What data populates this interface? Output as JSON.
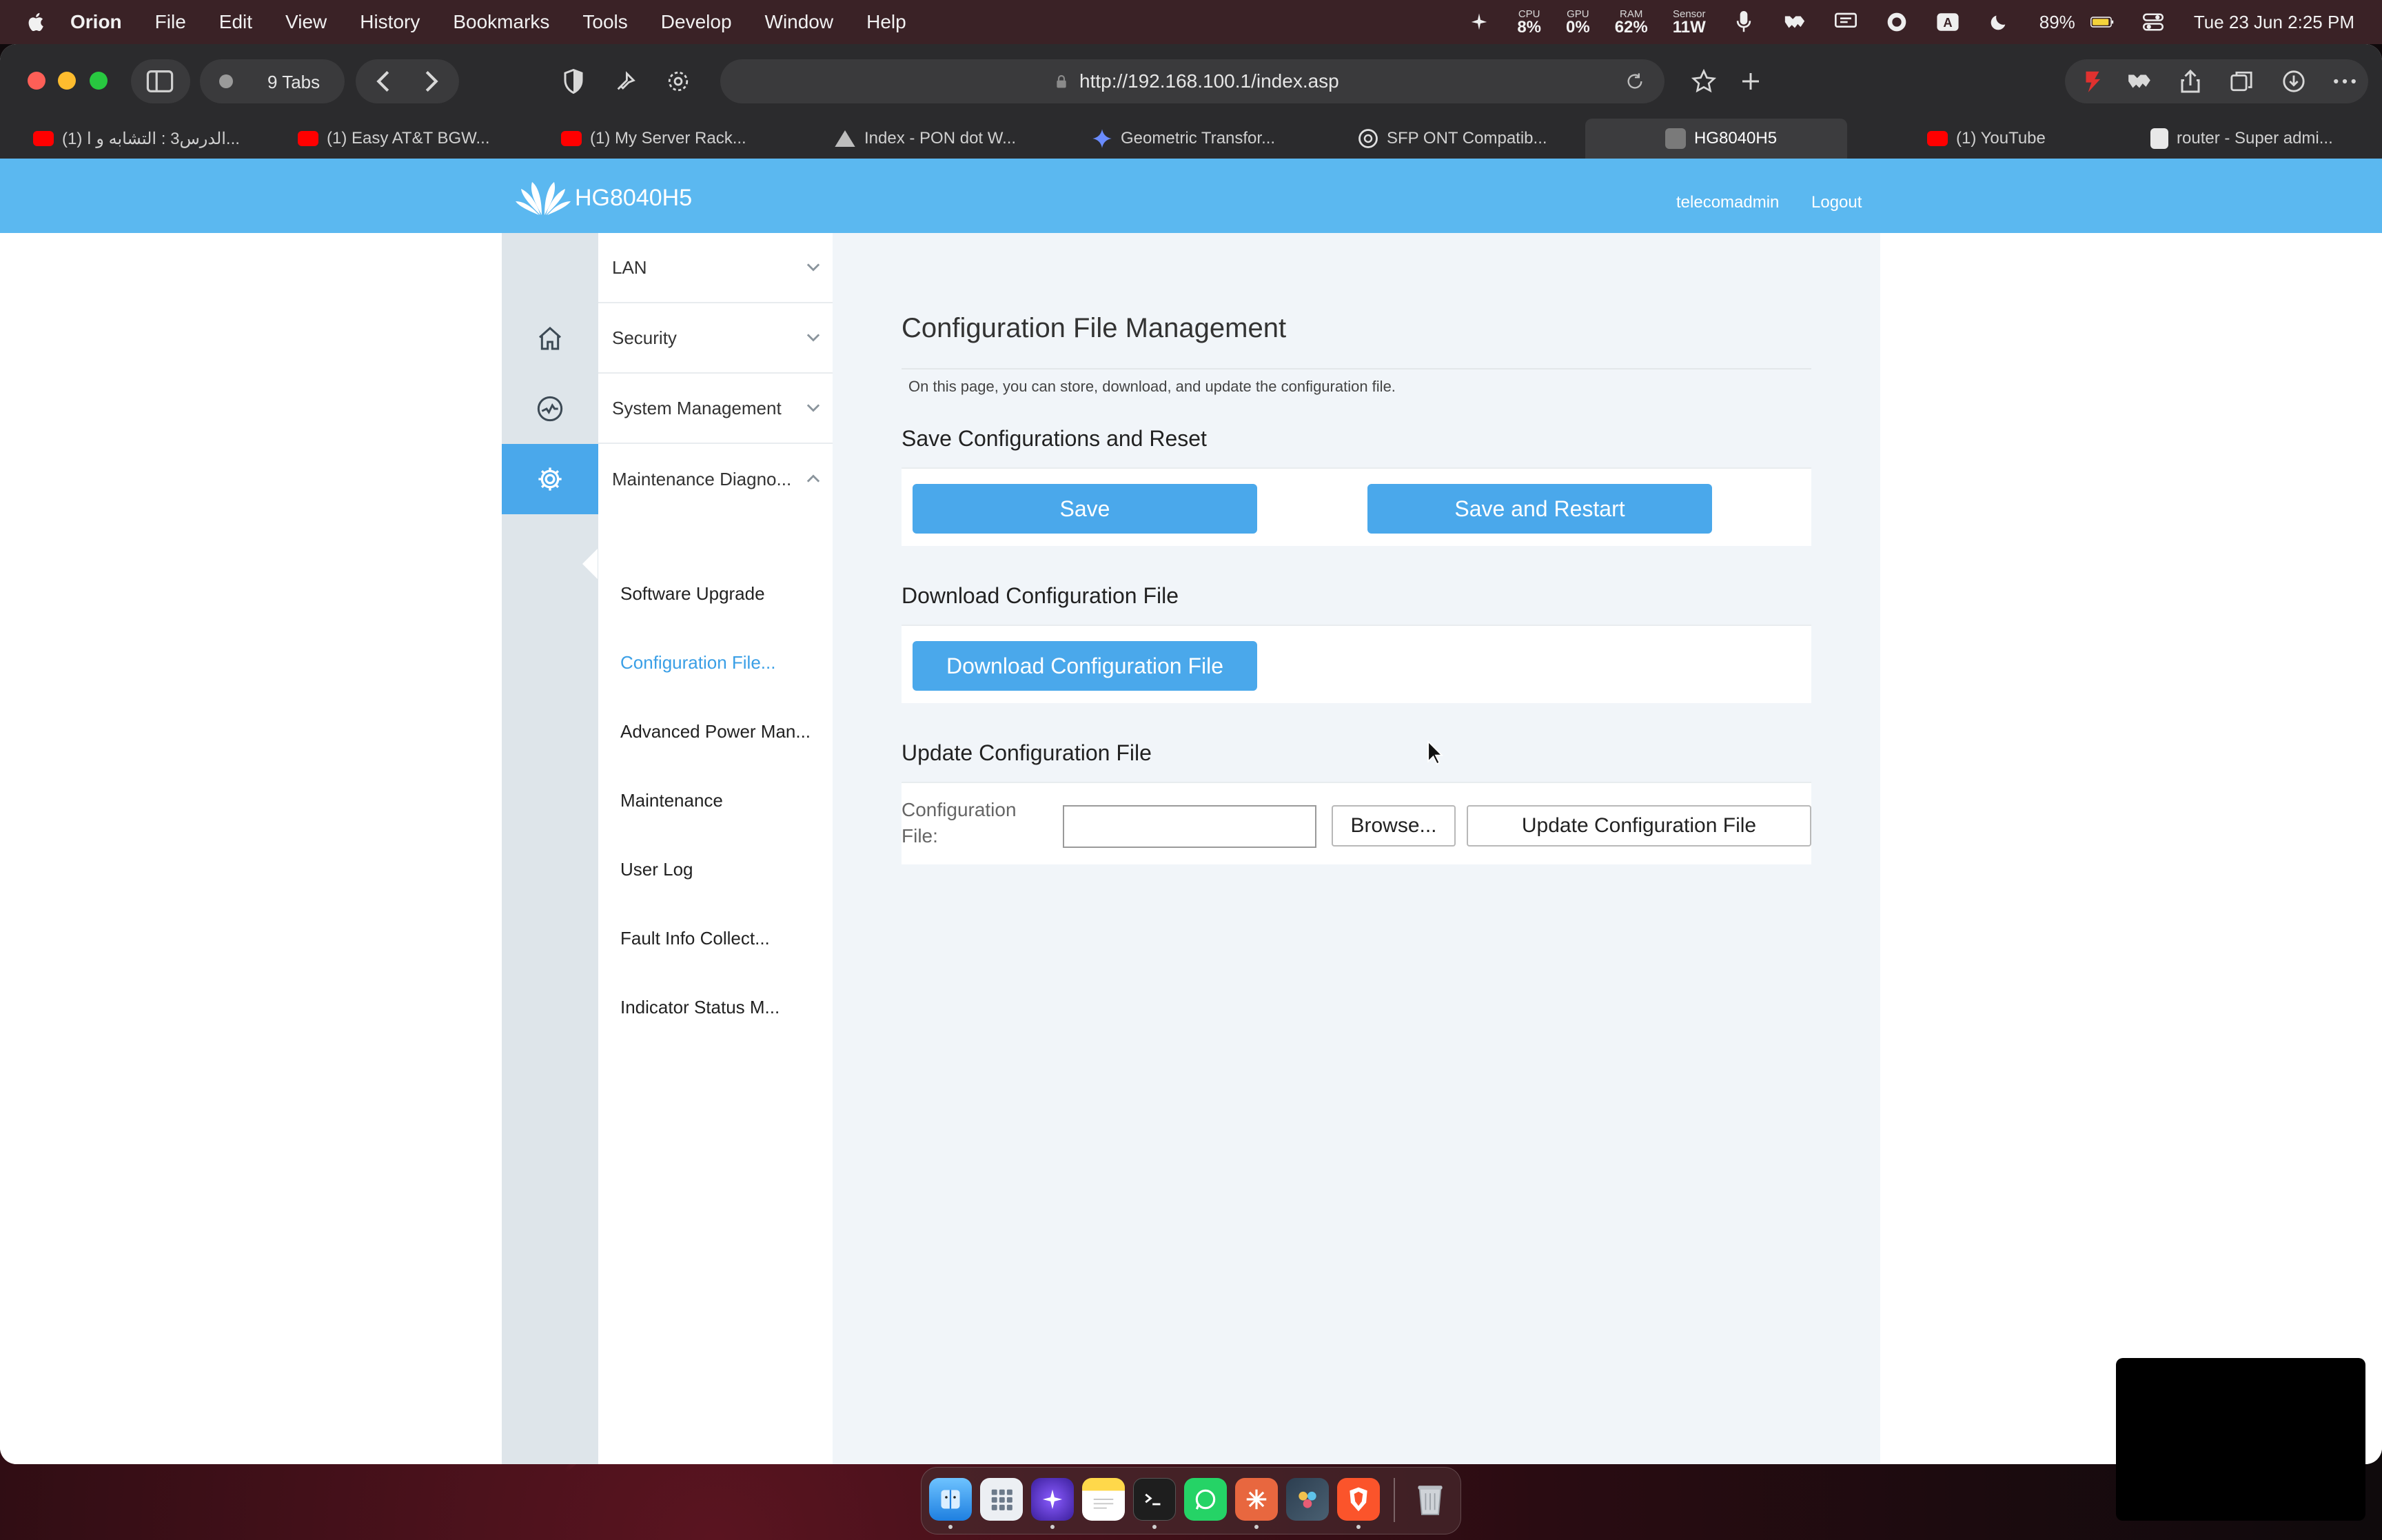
{
  "menubar": {
    "app_name": "Orion",
    "items": [
      "File",
      "Edit",
      "View",
      "History",
      "Bookmarks",
      "Tools",
      "Develop",
      "Window",
      "Help"
    ],
    "stats": [
      {
        "label": "CPU",
        "value": "8%"
      },
      {
        "label": "GPU",
        "value": "0%"
      },
      {
        "label": "RAM",
        "value": "62%"
      },
      {
        "label": "Sensor",
        "value": "11W"
      }
    ],
    "battery": "89%",
    "datetime": "Tue 23 Jun  2:25 PM"
  },
  "browser": {
    "tabs_count": "9 Tabs",
    "url": "http://192.168.100.1/index.asp",
    "tabs": [
      {
        "title": "(1) الدرس3 : التشابه و ا...",
        "favicon": "youtube-icon"
      },
      {
        "title": "(1) Easy AT&T BGW...",
        "favicon": "youtube-icon"
      },
      {
        "title": "(1) My Server Rack...",
        "favicon": "youtube-icon"
      },
      {
        "title": "Index - PON dot W...",
        "favicon": "triangle-icon"
      },
      {
        "title": "Geometric Transfor...",
        "favicon": "gemini-icon"
      },
      {
        "title": "SFP ONT Compatib...",
        "favicon": "openai-icon"
      },
      {
        "title": "HG8040H5",
        "favicon": "page-icon"
      },
      {
        "title": "(1) YouTube",
        "favicon": "youtube-icon"
      },
      {
        "title": "router - Super admi...",
        "favicon": "doc-icon"
      }
    ]
  },
  "router": {
    "product": "HG8040H5",
    "user": "telecomadmin",
    "logout": "Logout",
    "menu": {
      "lan": "LAN",
      "security": "Security",
      "system_management": "System Management",
      "maintenance": "Maintenance Diagno...",
      "sub_items": [
        "Software Upgrade",
        "Configuration File...",
        "Advanced Power Man...",
        "Maintenance",
        "User Log",
        "Fault Info Collect...",
        "Indicator Status M..."
      ]
    },
    "page": {
      "title": "Configuration File Management",
      "description": "On this page, you can store, download, and update the configuration file.",
      "save_section": "Save Configurations and Reset",
      "save_button": "Save",
      "save_restart_button": "Save and Restart",
      "download_section": "Download Configuration File",
      "download_button": "Download Configuration File",
      "update_section": "Update Configuration File",
      "file_label_line1": "Configuration",
      "file_label_line2": "File:",
      "file_value": "",
      "browse_button": "Browse...",
      "update_button": "Update Configuration File"
    }
  },
  "colors": {
    "header_blue": "#5bb8f0",
    "button_blue": "#4aa8eb",
    "active_link": "#3a9fe6"
  },
  "dock": [
    "finder-icon",
    "launchpad-icon",
    "orion-browser-icon",
    "notes-icon",
    "terminal-icon",
    "whatsapp-icon",
    "claude-icon",
    "davinci-icon",
    "brave-icon",
    "trash-icon"
  ]
}
